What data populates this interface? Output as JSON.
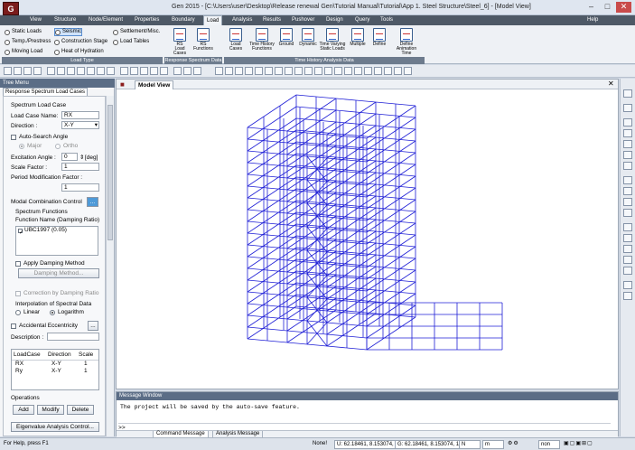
{
  "window": {
    "app_icon_text": "G",
    "title": "Gen 2015 - [C:\\Users\\user\\Desktop\\Release renewal Gen\\Tutorial Manual\\Tutorial\\App 1. Steel Structure\\Steel_6] - [Model View]"
  },
  "menu": [
    "View",
    "Structure",
    "Node/Element",
    "Properties",
    "Boundary",
    "Load",
    "Analysis",
    "Results",
    "Pushover",
    "Design",
    "Query",
    "Tools"
  ],
  "help_label": "Help",
  "ribbon": {
    "load_type": {
      "items": [
        "Static Loads",
        "Seismic",
        "Settlement/Misc.",
        "Temp./Prestress",
        "Construction Stage",
        "Load Tables",
        "Moving Load",
        "Heat of Hydration"
      ],
      "label": "Load Type"
    },
    "rs": {
      "items": [
        {
          "label": "RS\nLoad Cases"
        },
        {
          "label": "RS\nFunctions"
        }
      ],
      "label": "Response Spectrum Data"
    },
    "th": {
      "items": [
        {
          "label": "Load\nCases"
        },
        {
          "label": "Time History\nFunctions"
        },
        {
          "label": "Ground"
        },
        {
          "label": "Dynamic"
        },
        {
          "label": "Time Varying\nStatic Loads"
        },
        {
          "label": "Multiple"
        },
        {
          "label": "Define"
        },
        {
          "label": "Define\nAnimation Time"
        }
      ],
      "label": "Time History Analysis Data"
    }
  },
  "tree": {
    "header": "Tree Menu",
    "tab": "Response Spectrum Load Cases",
    "group_title": "Spectrum Load Case",
    "load_case_name_label": "Load Case Name:",
    "load_case_name_value": "RX",
    "direction_label": "Direction :",
    "direction_value": "X-Y",
    "auto_search_label": "Auto-Search Angle",
    "major_label": "Major",
    "ortho_label": "Ortho",
    "excitation_label": "Excitation Angle :",
    "excitation_value": "0",
    "excitation_unit": "[deg]",
    "scale_factor_label": "Scale Factor :",
    "scale_factor_value": "1",
    "period_mod_label": "Period Modification Factor :",
    "period_mod_value": "1",
    "modal_combo_label": "Modal Combination Control",
    "modal_combo_btn": "...",
    "spectrum_functions_label": "Spectrum Functions",
    "function_name_label": "Function Name (Damping Ratio)",
    "functions": [
      "UBC1997 (0.05)"
    ],
    "apply_damping_label": "Apply Damping Method",
    "damping_method_btn": "Damping Method...",
    "correction_label": "Correction by Damping Ratio",
    "interp_label": "Interpolation of Spectral Data",
    "linear_label": "Linear",
    "log_label": "Logarithm",
    "accidental_label": "Accidental Eccentricity",
    "accidental_btn": "...",
    "description_label": "Description :",
    "table": {
      "headers": [
        "LoadCase",
        "Direction",
        "Scale"
      ],
      "rows": [
        [
          "RX",
          "X-Y",
          "1"
        ],
        [
          "Ry",
          "X-Y",
          "1"
        ]
      ]
    },
    "operations_label": "Operations",
    "add_btn": "Add",
    "modify_btn": "Modify",
    "delete_btn": "Delete",
    "eigen_btn": "Eigenvalue Analysis Control..."
  },
  "view": {
    "tab_label": "Model View"
  },
  "message": {
    "header": "Message Window",
    "line": "The project will be saved by the auto-save feature.",
    "prompt": ">>",
    "tabs": [
      "Command Message",
      "Analysis Message"
    ]
  },
  "status": {
    "help": "For Help, press F1",
    "none": "None!",
    "u": "U: 62.18461, 8.153074, 1",
    "g": "G: 62.18461, 8.153074, 1",
    "unit1": "N",
    "unit2": "m",
    "unit3": "non"
  },
  "colors": {
    "frame": "#1f1fd6",
    "menubar": "#4e5966",
    "panel_header": "#5b6d86"
  }
}
